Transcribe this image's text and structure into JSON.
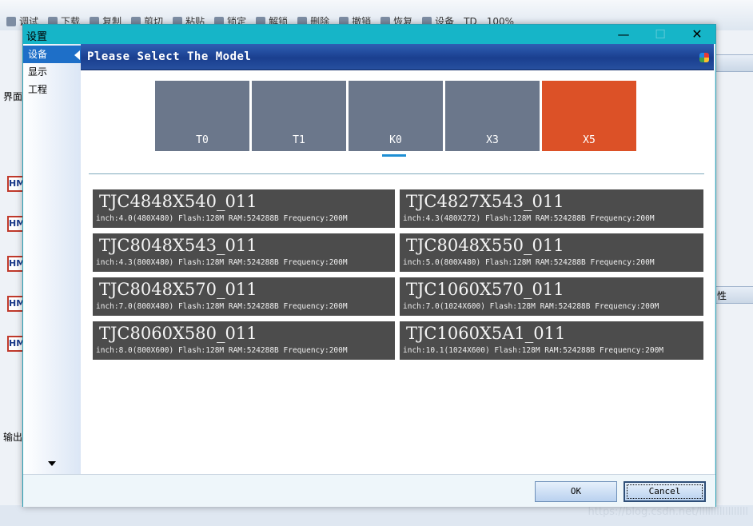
{
  "background_app": {
    "toolbar_items": [
      "调试",
      "下载",
      "复制",
      "剪切",
      "粘贴",
      "锁定",
      "解锁",
      "删除",
      "撤销",
      "恢复",
      "设备",
      "TD",
      "100%"
    ],
    "left_label": "界面",
    "icon_text": "HM",
    "bottom_label": "输出",
    "right_label": "性",
    "watermark": "https://blog.csdn.net/lllllllllllllllll"
  },
  "dialog": {
    "title": "设置",
    "window_buttons": {
      "minimize": "—",
      "maximize": "☐",
      "close": "✕"
    },
    "sidebar": {
      "items": [
        {
          "label": "设备",
          "active": true
        },
        {
          "label": "显示",
          "active": false
        },
        {
          "label": "工程",
          "active": false
        }
      ]
    },
    "header_title": "Please Select The Model",
    "series_tabs": [
      {
        "label": "T0",
        "selected": false
      },
      {
        "label": "T1",
        "selected": false
      },
      {
        "label": "K0",
        "selected": false
      },
      {
        "label": "X3",
        "selected": false
      },
      {
        "label": "X5",
        "selected": true
      }
    ],
    "models": [
      {
        "name": "TJC4848X540_011",
        "spec": "inch:4.0(480X480) Flash:128M RAM:524288B Frequency:200M"
      },
      {
        "name": "TJC4827X543_011",
        "spec": "inch:4.3(480X272) Flash:128M RAM:524288B Frequency:200M"
      },
      {
        "name": "TJC8048X543_011",
        "spec": "inch:4.3(800X480) Flash:128M RAM:524288B Frequency:200M"
      },
      {
        "name": "TJC8048X550_011",
        "spec": "inch:5.0(800X480) Flash:128M RAM:524288B Frequency:200M"
      },
      {
        "name": "TJC8048X570_011",
        "spec": "inch:7.0(800X480) Flash:128M RAM:524288B Frequency:200M"
      },
      {
        "name": "TJC1060X570_011",
        "spec": "inch:7.0(1024X600) Flash:128M RAM:524288B Frequency:200M"
      },
      {
        "name": "TJC8060X580_011",
        "spec": "inch:8.0(800X600) Flash:128M RAM:524288B Frequency:200M"
      },
      {
        "name": "TJC1060X5A1_011",
        "spec": "inch:10.1(1024X600) Flash:128M RAM:524288B Frequency:200M"
      }
    ],
    "buttons": {
      "ok": "OK",
      "cancel": "Cancel"
    },
    "colors": {
      "title_bar": "#16b5c8",
      "tab_default": "#6b778b",
      "tab_selected": "#dc5127",
      "card": "#4c4c4c",
      "header": "#1a3f8f"
    }
  }
}
